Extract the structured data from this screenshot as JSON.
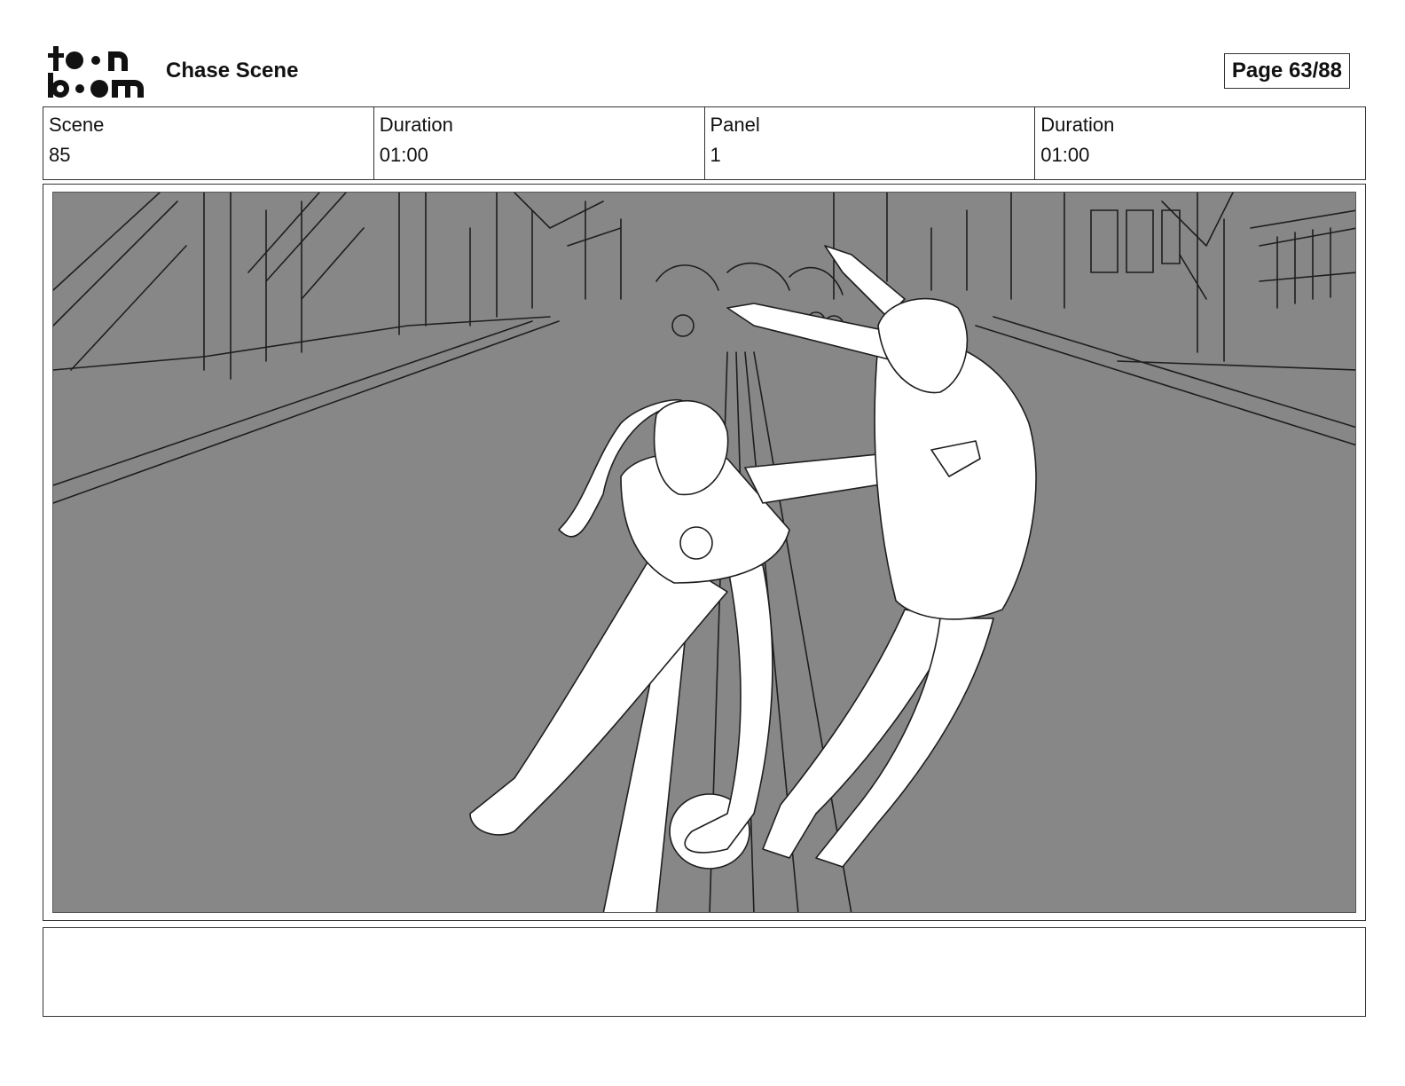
{
  "header": {
    "logo_text": "toonboom",
    "title": "Chase Scene",
    "page_label": "Page 63/88"
  },
  "meta": [
    {
      "label": "Scene",
      "value": "85"
    },
    {
      "label": "Duration",
      "value": "01:00"
    },
    {
      "label": "Panel",
      "value": "1"
    },
    {
      "label": "Duration",
      "value": "01:00"
    }
  ],
  "panel": {
    "background_color": "#878787",
    "line_color": "#1e1e1e",
    "figure_color": "#ffffff"
  },
  "notes": {
    "text": ""
  }
}
